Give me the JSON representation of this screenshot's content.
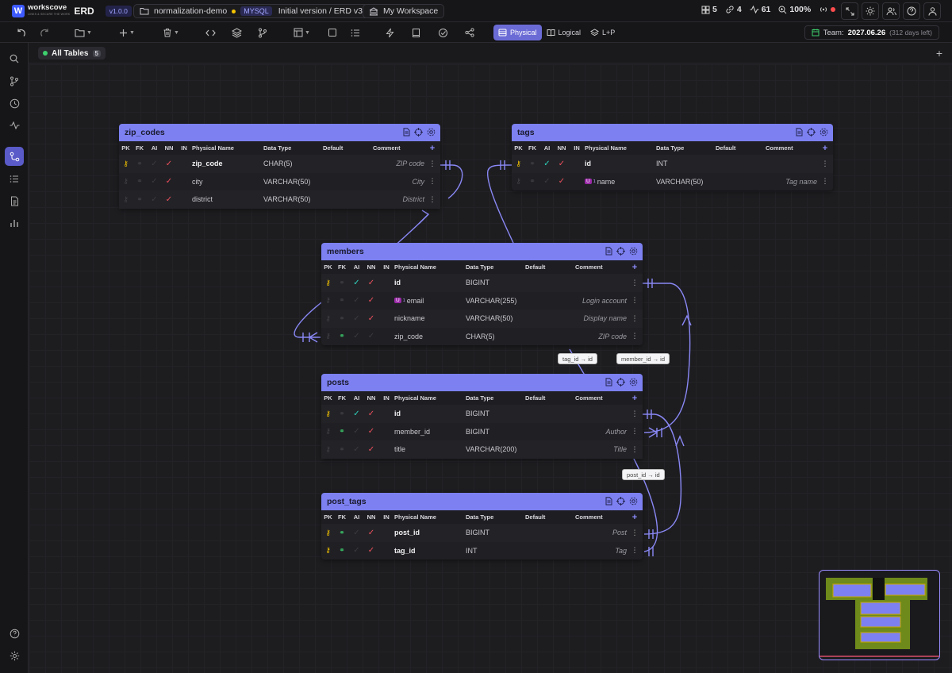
{
  "app": {
    "logo_letter": "W",
    "name": "workscove",
    "tagline": "LINKS & SECURE THE WORK",
    "product": "ERD",
    "version": "v1.0.0"
  },
  "project": {
    "name": "normalization-demo",
    "db": "MYSQL",
    "version_label": "Initial version / ERD v3"
  },
  "workspace": {
    "label": "My Workspace"
  },
  "stats": {
    "tables": "5",
    "relations": "4",
    "activity": "61",
    "zoom": "100%"
  },
  "toolbar": {
    "modes": [
      "Physical",
      "Logical",
      "L+P"
    ],
    "active_mode": "Physical",
    "team_label": "Team:",
    "team_date": "2027.06.26",
    "team_remaining": "(312 days left)"
  },
  "tabs": {
    "all_label": "All Tables",
    "count": "5",
    "add": "+"
  },
  "columns_header": {
    "pk": "PK",
    "fk": "FK",
    "ai": "AI",
    "nn": "NN",
    "in": "IN",
    "name": "Physical Name",
    "type": "Data Type",
    "default": "Default",
    "comment": "Comment",
    "add": "+"
  },
  "tables": {
    "zip_codes": {
      "name": "zip_codes",
      "rows": [
        {
          "name": "zip_code",
          "type": "CHAR(5)",
          "comment": "ZIP code"
        },
        {
          "name": "city",
          "type": "VARCHAR(50)",
          "comment": "City"
        },
        {
          "name": "district",
          "type": "VARCHAR(50)",
          "comment": "District"
        }
      ]
    },
    "tags": {
      "name": "tags",
      "rows": [
        {
          "name": "id",
          "type": "INT",
          "comment": ""
        },
        {
          "name": "name",
          "type": "VARCHAR(50)",
          "comment": "Tag name",
          "unique": "U",
          "unique_idx": "1"
        }
      ]
    },
    "members": {
      "name": "members",
      "rows": [
        {
          "name": "id",
          "type": "BIGINT",
          "comment": ""
        },
        {
          "name": "email",
          "type": "VARCHAR(255)",
          "comment": "Login account",
          "unique": "U",
          "unique_idx": "1"
        },
        {
          "name": "nickname",
          "type": "VARCHAR(50)",
          "comment": "Display name"
        },
        {
          "name": "zip_code",
          "type": "CHAR(5)",
          "comment": "ZIP code"
        }
      ]
    },
    "posts": {
      "name": "posts",
      "rows": [
        {
          "name": "id",
          "type": "BIGINT",
          "comment": ""
        },
        {
          "name": "member_id",
          "type": "BIGINT",
          "comment": "Author"
        },
        {
          "name": "title",
          "type": "VARCHAR(200)",
          "comment": "Title"
        }
      ]
    },
    "post_tags": {
      "name": "post_tags",
      "rows": [
        {
          "name": "post_id",
          "type": "BIGINT",
          "comment": "Post"
        },
        {
          "name": "tag_id",
          "type": "INT",
          "comment": "Tag"
        }
      ]
    }
  },
  "edge_labels": {
    "tag": "tag_id → id",
    "member": "member_id → id",
    "post": "post_id → id"
  },
  "colors": {
    "accent": "#7c80f0",
    "edge": "#8a88f5",
    "pk_key": "#f5c400",
    "fk_link": "#3ecf6e",
    "nn_check": "#ef4f5e",
    "ai_check": "#2dd4bf"
  }
}
